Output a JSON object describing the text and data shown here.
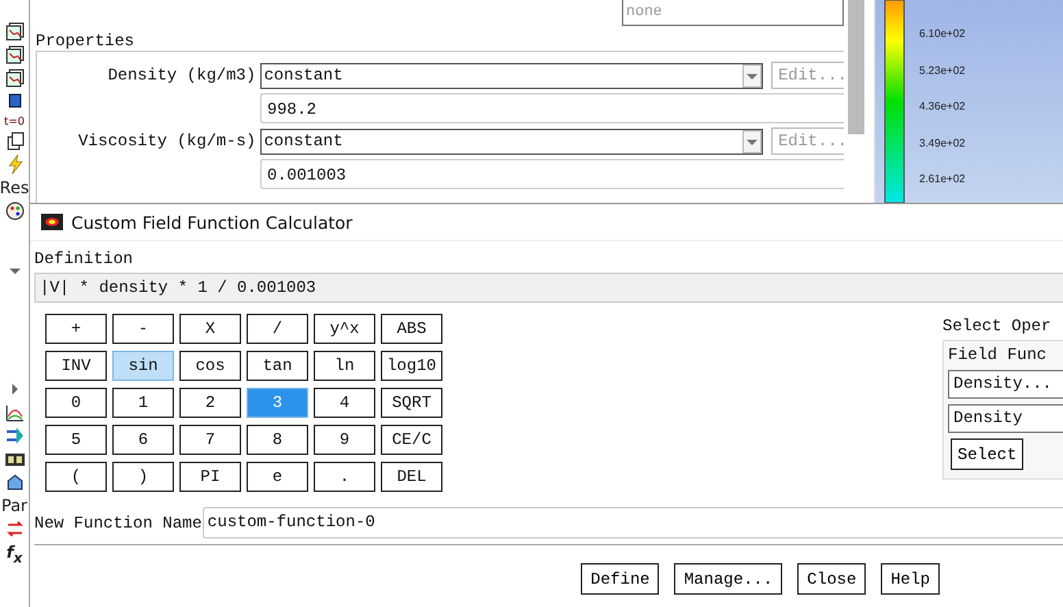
{
  "toolbar": {
    "texts": [
      {
        "kind": "t0",
        "text": "t=0"
      },
      {
        "kind": "res",
        "text": "Res"
      },
      {
        "kind": "par",
        "text": "Par"
      },
      {
        "kind": "fx",
        "text": "f$_{x}$"
      }
    ]
  },
  "properties": {
    "top_field": "none",
    "title": "Properties",
    "rows": [
      {
        "label": "Density (kg/m3)",
        "method": "constant",
        "edit": "Edit...",
        "value": "998.2"
      },
      {
        "label": "Viscosity (kg/m-s)",
        "method": "constant",
        "edit": "Edit...",
        "value": "0.001003"
      }
    ]
  },
  "colormap": {
    "labels": [
      "6.10e+02",
      "5.23e+02",
      "4.36e+02",
      "3.49e+02",
      "2.61e+02"
    ]
  },
  "dialog": {
    "title": "Custom Field Function Calculator",
    "definition_label": "Definition",
    "definition": "|V| * density * 1 / 0.001003",
    "keys": [
      {
        "label": "+",
        "selected": false,
        "hovered": false
      },
      {
        "label": "-",
        "selected": false,
        "hovered": false
      },
      {
        "label": "X",
        "selected": false,
        "hovered": false
      },
      {
        "label": "/",
        "selected": false,
        "hovered": false
      },
      {
        "label": "y^x",
        "selected": false,
        "hovered": false
      },
      {
        "label": "ABS",
        "selected": false,
        "hovered": false
      },
      {
        "label": "INV",
        "selected": false,
        "hovered": false
      },
      {
        "label": "sin",
        "selected": false,
        "hovered": true
      },
      {
        "label": "cos",
        "selected": false,
        "hovered": false
      },
      {
        "label": "tan",
        "selected": false,
        "hovered": false
      },
      {
        "label": "ln",
        "selected": false,
        "hovered": false
      },
      {
        "label": "log10",
        "selected": false,
        "hovered": false
      },
      {
        "label": "0",
        "selected": false,
        "hovered": false
      },
      {
        "label": "1",
        "selected": false,
        "hovered": false
      },
      {
        "label": "2",
        "selected": false,
        "hovered": false
      },
      {
        "label": "3",
        "selected": true,
        "hovered": false
      },
      {
        "label": "4",
        "selected": false,
        "hovered": false
      },
      {
        "label": "SQRT",
        "selected": false,
        "hovered": false
      },
      {
        "label": "5",
        "selected": false,
        "hovered": false
      },
      {
        "label": "6",
        "selected": false,
        "hovered": false
      },
      {
        "label": "7",
        "selected": false,
        "hovered": false
      },
      {
        "label": "8",
        "selected": false,
        "hovered": false
      },
      {
        "label": "9",
        "selected": false,
        "hovered": false
      },
      {
        "label": "CE/C",
        "selected": false,
        "hovered": false
      },
      {
        "label": "(",
        "selected": false,
        "hovered": false
      },
      {
        "label": ")",
        "selected": false,
        "hovered": false
      },
      {
        "label": "PI",
        "selected": false,
        "hovered": false
      },
      {
        "label": "e",
        "selected": false,
        "hovered": false
      },
      {
        "label": ".",
        "selected": false,
        "hovered": false
      },
      {
        "label": "DEL",
        "selected": false,
        "hovered": false
      }
    ],
    "select_operand": {
      "title": "Select Oper",
      "group": "Field Func",
      "list": "Density...",
      "value": "Density",
      "button": "Select"
    },
    "name_label": "New Function Name",
    "name_value": "custom-function-0",
    "buttons": [
      "Define",
      "Manage...",
      "Close",
      "Help"
    ]
  }
}
